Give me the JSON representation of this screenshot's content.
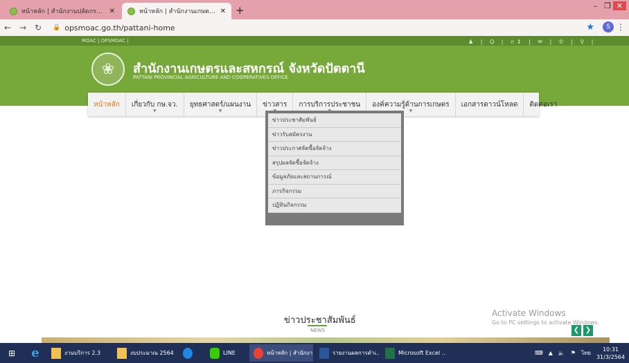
{
  "browser": {
    "tabs": [
      {
        "title": "หน้าหลัก | สำนักงานปลัดกระทรวงเกษตร",
        "active": false
      },
      {
        "title": "หน้าหลัก | สำนักงานเกษตรและสหกรณ์",
        "active": true
      }
    ],
    "new_tab": "+",
    "url": "opsmoac.go.th/pattani-home",
    "profile_initial": "S"
  },
  "site": {
    "top_links": "MOAC  |  OPSMOAC  |",
    "top_icons": "♟ | Q | ก↕ | ✉ | ✆ | ⚲ |",
    "title_th": "สำนักงานเกษตรและสหกรณ์ จังหวัดปัตตานี",
    "title_en": "PATTANI PROVINCIAL AGRICULTURE AND COOPERATIVES OFFICE",
    "menu": [
      {
        "label": "หน้าหลัก",
        "caret": false
      },
      {
        "label": "เกี่ยวกับ กษ.จว.",
        "caret": true
      },
      {
        "label": "ยุทธศาสตร์/แผนงาน",
        "caret": true
      },
      {
        "label": "ข่าวสาร",
        "caret": true
      },
      {
        "label": "การบริการประชาชน",
        "caret": true
      },
      {
        "label": "องค์ความรู้ด้านการเกษตร",
        "caret": true
      },
      {
        "label": "เอกสารดาวน์โหลด",
        "caret": false
      },
      {
        "label": "ติดต่อเรา",
        "caret": false
      }
    ],
    "dropdown": [
      "ข่าวประชาสัมพันธ์",
      "ข่าวรับสมัครงาน",
      "ข่าวประกาศจัดซื้อจัดจ้าง",
      "สรุปผลจัดซื้อจัดจ้าง",
      "ข้อมูลภัยและสถานการณ์",
      "ภารกิจกรรม",
      "ปฏิทินกิจกรรม"
    ],
    "news_title": "ข่าวประชาสัมพันธ์",
    "news_sub": "NEWS"
  },
  "activation": {
    "line1": "Activate Windows",
    "line2": "Go to PC settings to activate Windows."
  },
  "taskbar": {
    "items": [
      {
        "label": "งานบริการ 2.3",
        "color": "#f2c14e"
      },
      {
        "label": "งบประมาณ 2564",
        "color": "#f2c14e"
      },
      {
        "label": "",
        "color": "#1e88e5"
      },
      {
        "label": "LINE",
        "color": "#39cd00"
      },
      {
        "label": "หน้าหลัก | สำนักงา...",
        "color": "#ea4335"
      },
      {
        "label": "รายงานผลการดำเ...",
        "color": "#2b579a"
      },
      {
        "label": "Microsoft Excel ...",
        "color": "#217346"
      }
    ],
    "lang": "ไทย",
    "time": "10:31",
    "date": "31/3/2564"
  }
}
